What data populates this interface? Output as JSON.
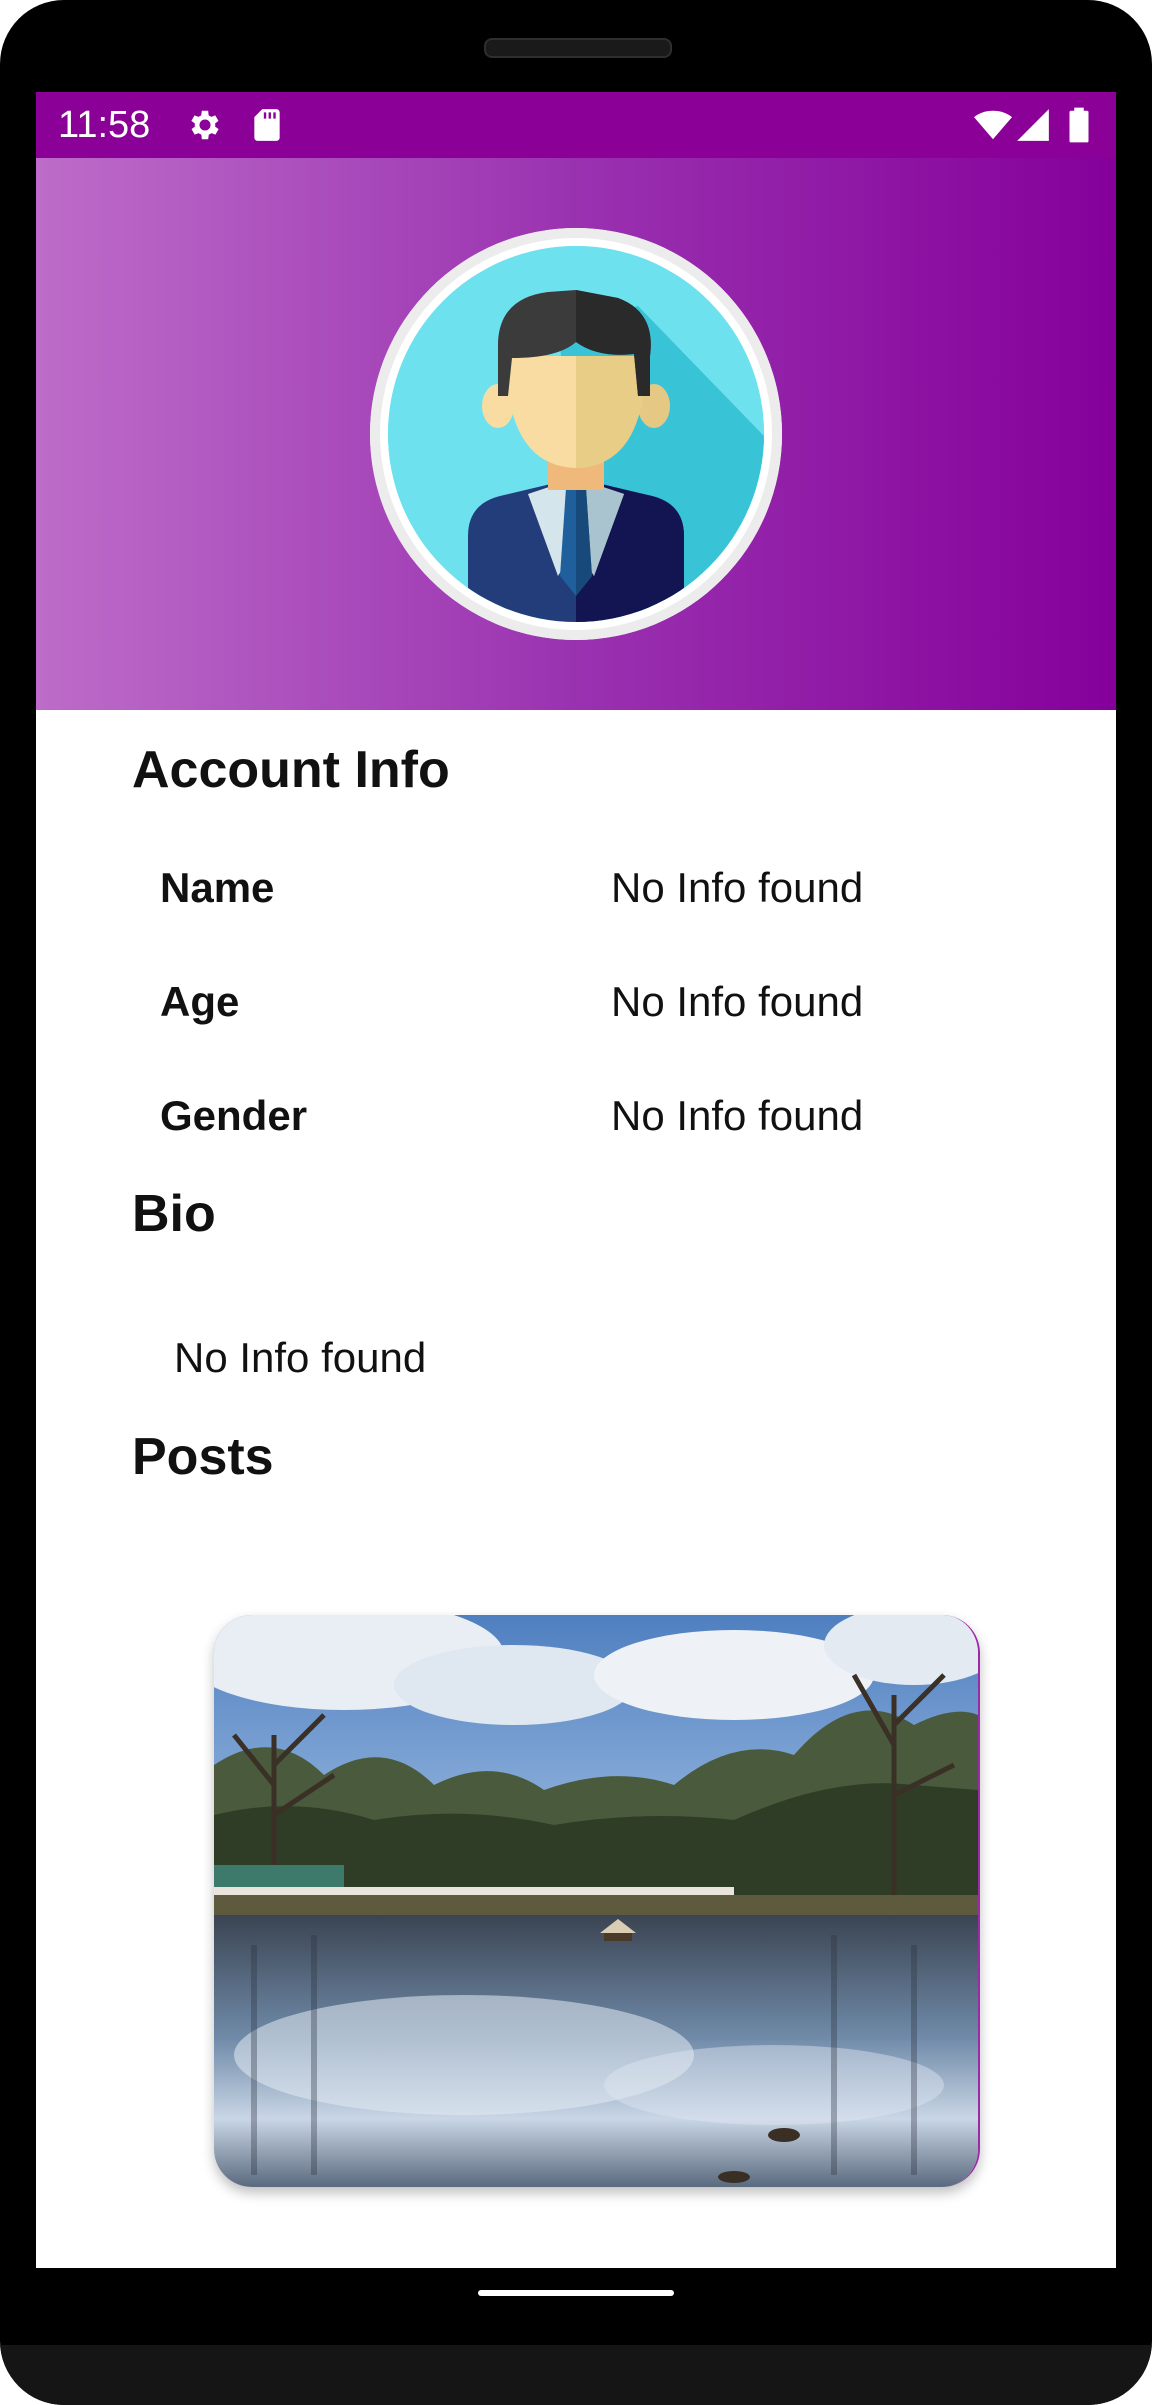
{
  "status_bar": {
    "time": "11:58",
    "icons": [
      "gear-icon",
      "sd-card-icon",
      "wifi-icon",
      "signal-icon",
      "battery-icon"
    ],
    "background": "#8b0096"
  },
  "header": {
    "gradient_start": "#bd6cc9",
    "gradient_end": "#85009b",
    "avatar": "businessman-avatar-icon"
  },
  "account_info": {
    "title": "Account Info",
    "rows": [
      {
        "label": "Name",
        "value": "No Info found"
      },
      {
        "label": "Age",
        "value": "No Info found"
      },
      {
        "label": "Gender",
        "value": "No Info found"
      }
    ]
  },
  "bio": {
    "title": "Bio",
    "text": "No Info found"
  },
  "posts": {
    "title": "Posts",
    "items": [
      {
        "image": "lake-with-trees-photo"
      }
    ]
  }
}
